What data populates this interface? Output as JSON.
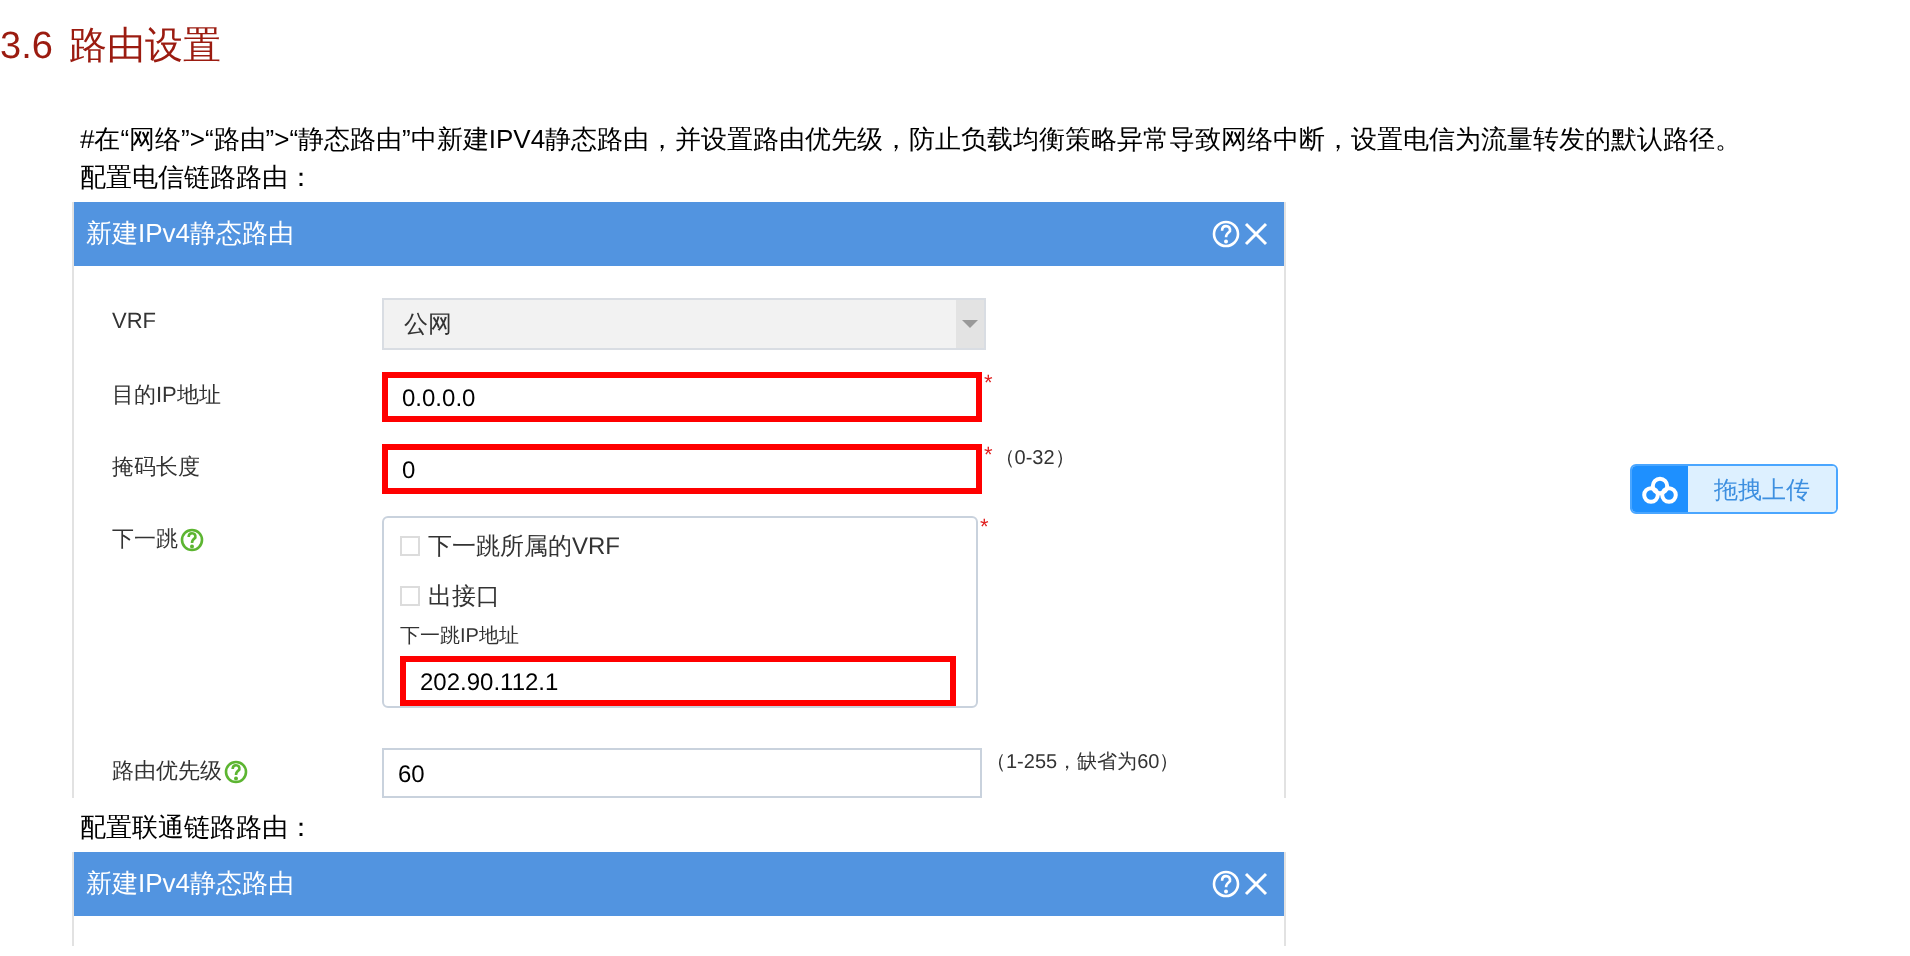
{
  "heading": {
    "number": "3.6",
    "title": "路由设置"
  },
  "intro": "#在“网络”>“路由”>“静态路由”中新建IPV4静态路由，并设置路由优先级，防止负载均衡策略异常导致网络中断，设置电信为流量转发的默认路径。",
  "sections": [
    {
      "caption": "配置电信链路路由：",
      "dialog": {
        "title": "新建IPv4静态路由",
        "fields": [
          {
            "kind": "select",
            "label": "VRF",
            "value": "公网"
          },
          {
            "kind": "input",
            "label": "目的IP地址",
            "value": "0.0.0.0",
            "required_mark": "*",
            "highlighted": true
          },
          {
            "kind": "input",
            "label": "掩码长度",
            "value": "0",
            "required_mark": "*",
            "highlighted": true,
            "hint": "（0-32）"
          },
          {
            "kind": "nexthop",
            "label": "下一跳",
            "help": true,
            "required_mark": "*",
            "options": [
              {
                "label": "下一跳所属的VRF",
                "checked": false
              },
              {
                "label": "出接口",
                "checked": false
              }
            ],
            "ip_label": "下一跳IP地址",
            "ip_value": "202.90.112.1",
            "highlighted": true
          },
          {
            "kind": "input",
            "label": "路由优先级",
            "help": true,
            "value": "60",
            "highlighted": false,
            "hint": "（1-255，缺省为60）"
          }
        ]
      }
    },
    {
      "caption": "配置联通链路路由：",
      "dialog": {
        "title": "新建IPv4静态路由"
      }
    }
  ],
  "upload_button": {
    "label": "拖拽上传"
  }
}
